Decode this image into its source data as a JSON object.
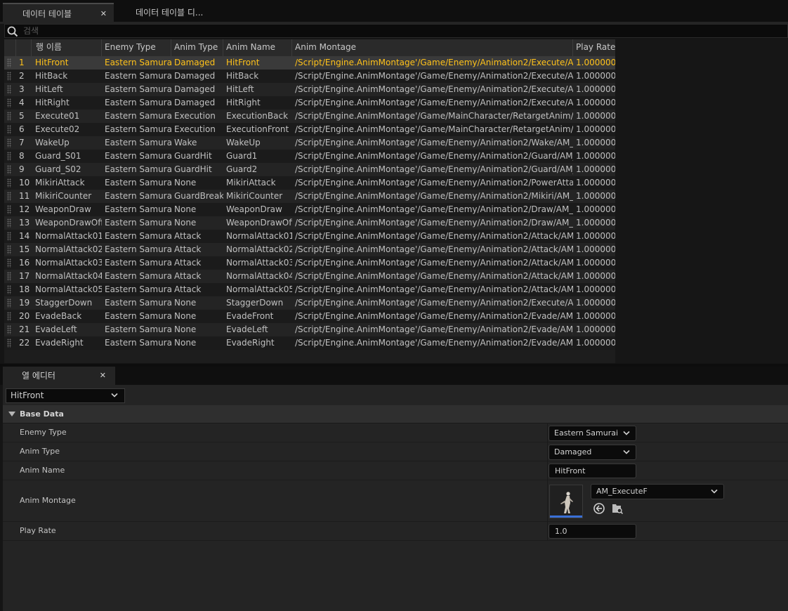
{
  "tabs": [
    {
      "label": "데이터 테이블",
      "close": "✕"
    },
    {
      "label": "데이터 테이블 디..."
    }
  ],
  "search": {
    "placeholder": "검색"
  },
  "table": {
    "headers": [
      "행 이름",
      "Enemy Type",
      "Anim Type",
      "Anim Name",
      "Anim Montage",
      "Play Rate"
    ],
    "rows": [
      {
        "num": "1",
        "name": "HitFront",
        "enemy": "Eastern Samurai",
        "type": "Damaged",
        "anim": "HitFront",
        "montage": "/Script/Engine.AnimMontage'/Game/Enemy/Animation2/Execute/AM_Execute",
        "rate": "1.000000"
      },
      {
        "num": "2",
        "name": "HitBack",
        "enemy": "Eastern Samurai",
        "type": "Damaged",
        "anim": "HitBack",
        "montage": "/Script/Engine.AnimMontage'/Game/Enemy/Animation2/Execute/AM_Execute",
        "rate": "1.000000"
      },
      {
        "num": "3",
        "name": "HitLeft",
        "enemy": "Eastern Samurai",
        "type": "Damaged",
        "anim": "HitLeft",
        "montage": "/Script/Engine.AnimMontage'/Game/Enemy/Animation2/Execute/AM_Execute",
        "rate": "1.000000"
      },
      {
        "num": "4",
        "name": "HitRight",
        "enemy": "Eastern Samurai",
        "type": "Damaged",
        "anim": "HitRight",
        "montage": "/Script/Engine.AnimMontage'/Game/Enemy/Animation2/Execute/AM_Execute",
        "rate": "1.000000"
      },
      {
        "num": "5",
        "name": "Execute01",
        "enemy": "Eastern Samurai",
        "type": "Execution",
        "anim": "ExecutionBack",
        "montage": "/Script/Engine.AnimMontage'/Game/MainCharacter/RetargetAnim/Execution",
        "rate": "1.000000"
      },
      {
        "num": "6",
        "name": "Execute02",
        "enemy": "Eastern Samurai",
        "type": "Execution",
        "anim": "ExecutionFront",
        "montage": "/Script/Engine.AnimMontage'/Game/MainCharacter/RetargetAnim/Execution",
        "rate": "1.000000"
      },
      {
        "num": "7",
        "name": "WakeUp",
        "enemy": "Eastern Samurai",
        "type": "Wake",
        "anim": "WakeUp",
        "montage": "/Script/Engine.AnimMontage'/Game/Enemy/Animation2/Wake/AM_WakeUp",
        "rate": "1.000000"
      },
      {
        "num": "8",
        "name": "Guard_S01",
        "enemy": "Eastern Samurai",
        "type": "GuardHit",
        "anim": "Guard1",
        "montage": "/Script/Engine.AnimMontage'/Game/Enemy/Animation2/Guard/AM_Normal",
        "rate": "1.000000"
      },
      {
        "num": "9",
        "name": "Guard_S02",
        "enemy": "Eastern Samurai",
        "type": "GuardHit",
        "anim": "Guard2",
        "montage": "/Script/Engine.AnimMontage'/Game/Enemy/Animation2/Guard/AM_Normal",
        "rate": "1.000000"
      },
      {
        "num": "10",
        "name": "MikiriAttack",
        "enemy": "Eastern Samurai",
        "type": "None",
        "anim": "MikiriAttack",
        "montage": "/Script/Engine.AnimMontage'/Game/Enemy/Animation2/PowerAttack/AM_",
        "rate": "1.000000"
      },
      {
        "num": "11",
        "name": "MikiriCounter",
        "enemy": "Eastern Samurai",
        "type": "GuardBreak",
        "anim": "MikiriCounter",
        "montage": "/Script/Engine.AnimMontage'/Game/Enemy/Animation2/Mikiri/AM_Mikiri",
        "rate": "1.000000"
      },
      {
        "num": "12",
        "name": "WeaponDraw",
        "enemy": "Eastern Samurai",
        "type": "None",
        "anim": "WeaponDraw",
        "montage": "/Script/Engine.AnimMontage'/Game/Enemy/Animation2/Draw/AM_Draw",
        "rate": "1.000000"
      },
      {
        "num": "13",
        "name": "WeaponDrawOff",
        "enemy": "Eastern Samurai",
        "type": "None",
        "anim": "WeaponDrawOff",
        "montage": "/Script/Engine.AnimMontage'/Game/Enemy/Animation2/Draw/AM_Draw",
        "rate": "1.000000"
      },
      {
        "num": "14",
        "name": "NormalAttack01",
        "enemy": "Eastern Samurai",
        "type": "Attack",
        "anim": "NormalAttack01",
        "montage": "/Script/Engine.AnimMontage'/Game/Enemy/Animation2/Attack/AM_Normal",
        "rate": "1.000000"
      },
      {
        "num": "15",
        "name": "NormalAttack02",
        "enemy": "Eastern Samurai",
        "type": "Attack",
        "anim": "NormalAttack02",
        "montage": "/Script/Engine.AnimMontage'/Game/Enemy/Animation2/Attack/AM_Normal",
        "rate": "1.000000"
      },
      {
        "num": "16",
        "name": "NormalAttack03",
        "enemy": "Eastern Samurai",
        "type": "Attack",
        "anim": "NormalAttack03",
        "montage": "/Script/Engine.AnimMontage'/Game/Enemy/Animation2/Attack/AM_Normal",
        "rate": "1.000000"
      },
      {
        "num": "17",
        "name": "NormalAttack04",
        "enemy": "Eastern Samurai",
        "type": "Attack",
        "anim": "NormalAttack04",
        "montage": "/Script/Engine.AnimMontage'/Game/Enemy/Animation2/Attack/AM_Normal",
        "rate": "1.000000"
      },
      {
        "num": "18",
        "name": "NormalAttack05",
        "enemy": "Eastern Samurai",
        "type": "Attack",
        "anim": "NormalAttack05",
        "montage": "/Script/Engine.AnimMontage'/Game/Enemy/Animation2/Attack/AM_Normal",
        "rate": "1.000000"
      },
      {
        "num": "19",
        "name": "StaggerDown",
        "enemy": "Eastern Samurai",
        "type": "None",
        "anim": "StaggerDown",
        "montage": "/Script/Engine.AnimMontage'/Game/Enemy/Animation2/Execute/AM_Knock",
        "rate": "1.000000"
      },
      {
        "num": "20",
        "name": "EvadeBack",
        "enemy": "Eastern Samurai",
        "type": "None",
        "anim": "EvadeFront",
        "montage": "/Script/Engine.AnimMontage'/Game/Enemy/Animation2/Evade/AM_Evade",
        "rate": "1.000000"
      },
      {
        "num": "21",
        "name": "EvadeLeft",
        "enemy": "Eastern Samurai",
        "type": "None",
        "anim": "EvadeLeft",
        "montage": "/Script/Engine.AnimMontage'/Game/Enemy/Animation2/Evade/AM_Evade",
        "rate": "1.000000"
      },
      {
        "num": "22",
        "name": "EvadeRight",
        "enemy": "Eastern Samurai",
        "type": "None",
        "anim": "EvadeRight",
        "montage": "/Script/Engine.AnimMontage'/Game/Enemy/Animation2/Evade/AM_Evade",
        "rate": "1.000000"
      }
    ]
  },
  "editor": {
    "tab": {
      "label": "열 에디터",
      "close": "✕"
    },
    "row_selector": "HitFront",
    "category": "Base Data",
    "props": {
      "enemy_type": {
        "label": "Enemy Type",
        "value": "Eastern Samurai"
      },
      "anim_type": {
        "label": "Anim Type",
        "value": "Damaged"
      },
      "anim_name": {
        "label": "Anim Name",
        "value": "HitFront"
      },
      "anim_montage": {
        "label": "Anim Montage",
        "value": "AM_ExecuteF"
      },
      "play_rate": {
        "label": "Play Rate",
        "value": "1.0"
      }
    }
  },
  "colors": {
    "selected_text": "#ffc21a",
    "background": "#242424",
    "thumb_accent": "#3a6fd6"
  },
  "icons": [
    "search-icon",
    "close-icon",
    "chevron-down-icon",
    "collapse-triangle-icon",
    "use-selected-asset-icon",
    "browse-asset-icon",
    "row-grip-icon"
  ]
}
